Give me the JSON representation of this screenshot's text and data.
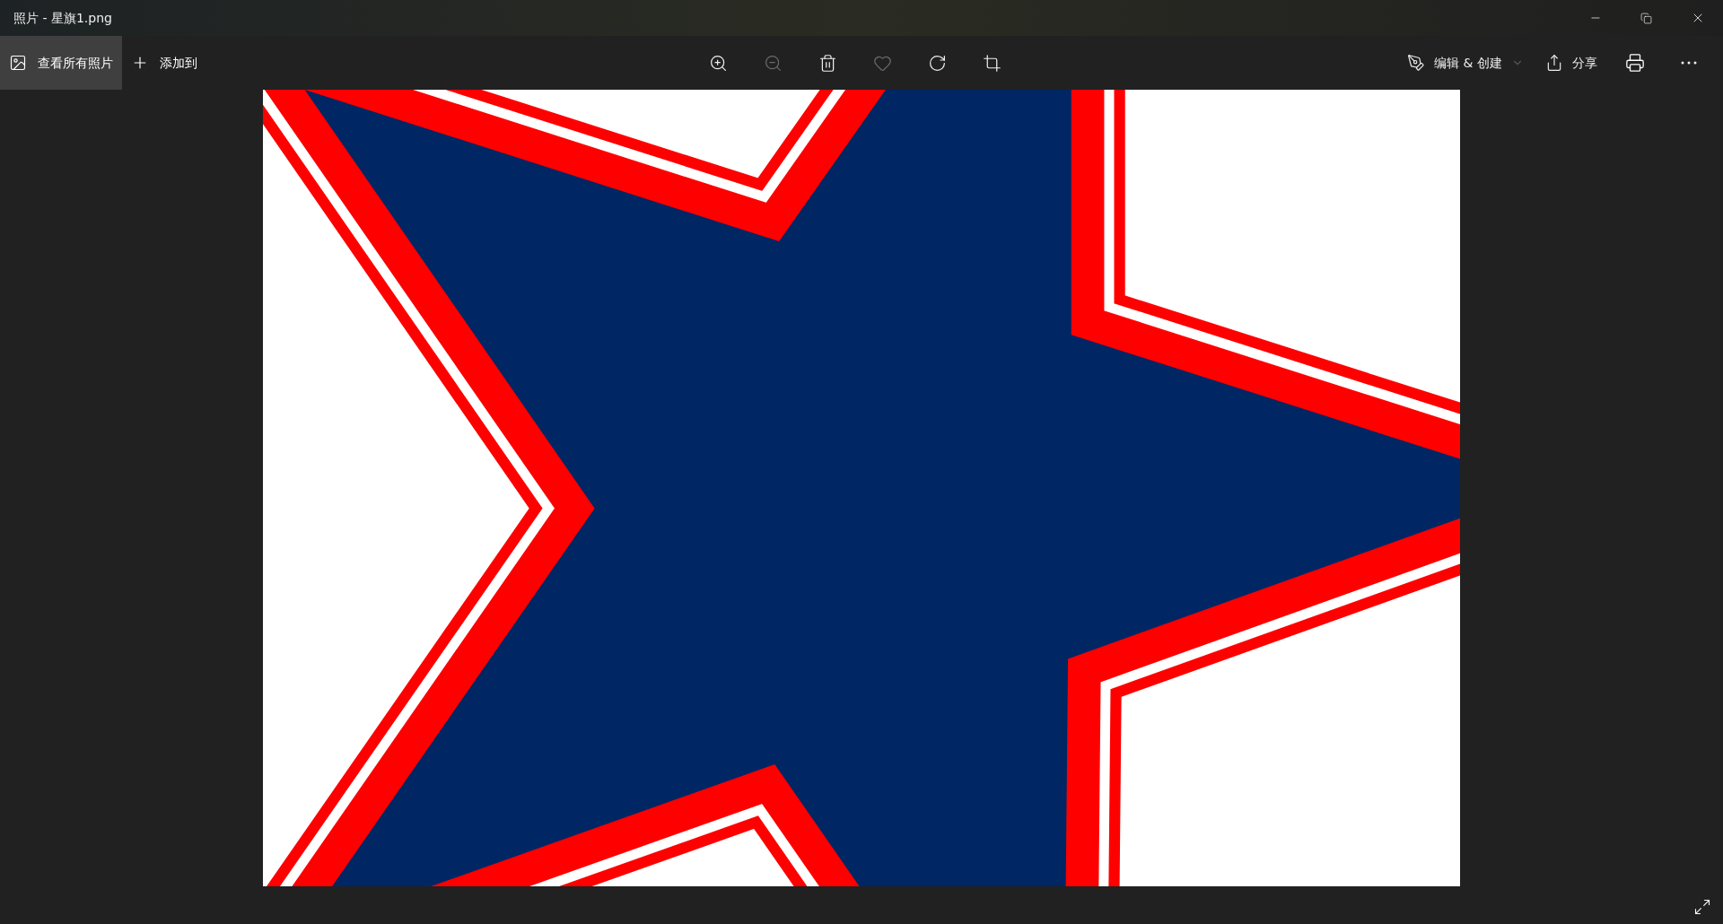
{
  "window": {
    "title": "照片 - 星旗1.png"
  },
  "toolbar_left": [
    {
      "kind": "gallery",
      "label": "查看所有照片",
      "selected": true
    },
    {
      "kind": "add",
      "label": "添加到",
      "selected": false
    }
  ],
  "toolbar_center": [
    {
      "kind": "zoom-in",
      "disabled": false
    },
    {
      "kind": "zoom-out",
      "disabled": true
    },
    {
      "kind": "delete",
      "disabled": false
    },
    {
      "kind": "favorite",
      "disabled": true
    },
    {
      "kind": "rotate",
      "disabled": false
    },
    {
      "kind": "crop",
      "disabled": false
    }
  ],
  "toolbar_right": [
    {
      "kind": "edit",
      "label": "编辑 & 创建",
      "dropdown": true
    },
    {
      "kind": "share",
      "label": "分享",
      "dropdown": false
    }
  ]
}
